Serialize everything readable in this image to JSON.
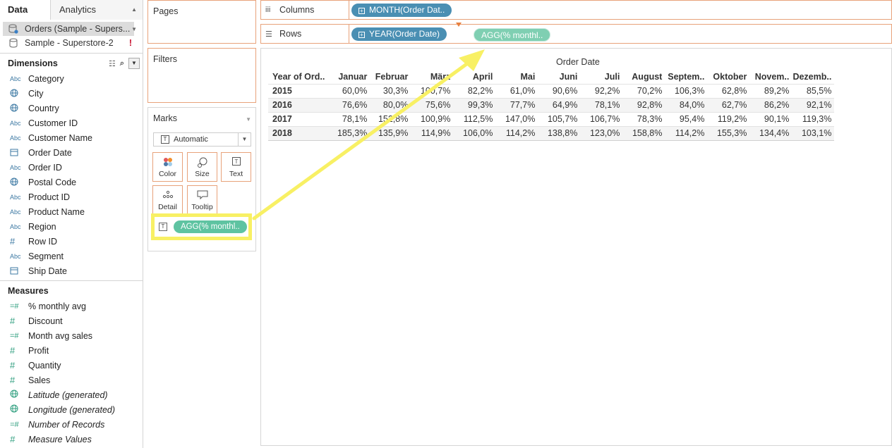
{
  "tabs": {
    "data": "Data",
    "analytics": "Analytics"
  },
  "sources": [
    {
      "name": "Orders (Sample - Supers...",
      "selected": true
    },
    {
      "name": "Sample - Superstore-2",
      "warning": "!"
    }
  ],
  "dimensions": {
    "title": "Dimensions",
    "items": [
      {
        "label": "Category",
        "icon": "Abc"
      },
      {
        "label": "City",
        "icon": "globe"
      },
      {
        "label": "Country",
        "icon": "globe"
      },
      {
        "label": "Customer ID",
        "icon": "Abc"
      },
      {
        "label": "Customer Name",
        "icon": "Abc"
      },
      {
        "label": "Order Date",
        "icon": "calendar"
      },
      {
        "label": "Order ID",
        "icon": "Abc"
      },
      {
        "label": "Postal Code",
        "icon": "globe"
      },
      {
        "label": "Product ID",
        "icon": "Abc"
      },
      {
        "label": "Product Name",
        "icon": "Abc"
      },
      {
        "label": "Region",
        "icon": "Abc"
      },
      {
        "label": "Row ID",
        "icon": "#"
      },
      {
        "label": "Segment",
        "icon": "Abc"
      },
      {
        "label": "Ship Date",
        "icon": "calendar"
      }
    ]
  },
  "measures": {
    "title": "Measures",
    "items": [
      {
        "label": "% monthly avg",
        "icon": "=#"
      },
      {
        "label": "Discount",
        "icon": "#"
      },
      {
        "label": "Month avg sales",
        "icon": "=#"
      },
      {
        "label": "Profit",
        "icon": "#"
      },
      {
        "label": "Quantity",
        "icon": "#"
      },
      {
        "label": "Sales",
        "icon": "#"
      },
      {
        "label": "Latitude (generated)",
        "icon": "globe",
        "italic": true
      },
      {
        "label": "Longitude (generated)",
        "icon": "globe",
        "italic": true
      },
      {
        "label": "Number of Records",
        "icon": "=#",
        "italic": true
      },
      {
        "label": "Measure Values",
        "icon": "#",
        "italic": true
      }
    ]
  },
  "cards": {
    "pages": "Pages",
    "filters": "Filters",
    "marks": "Marks",
    "mark_type": "Automatic",
    "buttons": {
      "color": "Color",
      "size": "Size",
      "text": "Text",
      "detail": "Detail",
      "tooltip": "Tooltip"
    },
    "text_pill": "AGG(% monthl.."
  },
  "shelves": {
    "columns_label": "Columns",
    "rows_label": "Rows",
    "columns_pill": "MONTH(Order Dat..",
    "rows_pill": "YEAR(Order Date)",
    "dragged_pill": "AGG(% monthl.."
  },
  "view": {
    "header": "Order Date",
    "row_header": "Year of Ord..",
    "columns": [
      "Januar",
      "Februar",
      "März",
      "April",
      "Mai",
      "Juni",
      "Juli",
      "August",
      "Septem..",
      "Oktober",
      "Novem..",
      "Dezemb.."
    ],
    "rows": [
      {
        "year": "2015",
        "values": [
          "60,0%",
          "30,3%",
          "100,7%",
          "82,2%",
          "61,0%",
          "90,6%",
          "92,2%",
          "70,2%",
          "106,3%",
          "62,8%",
          "89,2%",
          "85,5%"
        ]
      },
      {
        "year": "2016",
        "values": [
          "76,6%",
          "80,0%",
          "75,6%",
          "99,3%",
          "77,7%",
          "64,9%",
          "78,1%",
          "92,8%",
          "84,0%",
          "62,7%",
          "86,2%",
          "92,1%"
        ]
      },
      {
        "year": "2017",
        "values": [
          "78,1%",
          "152,8%",
          "100,9%",
          "112,5%",
          "147,0%",
          "105,7%",
          "106,7%",
          "78,3%",
          "95,4%",
          "119,2%",
          "90,1%",
          "119,3%"
        ]
      },
      {
        "year": "2018",
        "values": [
          "185,3%",
          "135,9%",
          "114,9%",
          "106,0%",
          "114,2%",
          "138,8%",
          "123,0%",
          "158,8%",
          "114,2%",
          "155,3%",
          "134,4%",
          "103,1%"
        ]
      }
    ]
  },
  "colors": {
    "pill_blue": "#4a8fb3",
    "pill_green": "#5ec3a1",
    "highlight": "#f8f064",
    "card_border": "#e8a27a"
  }
}
